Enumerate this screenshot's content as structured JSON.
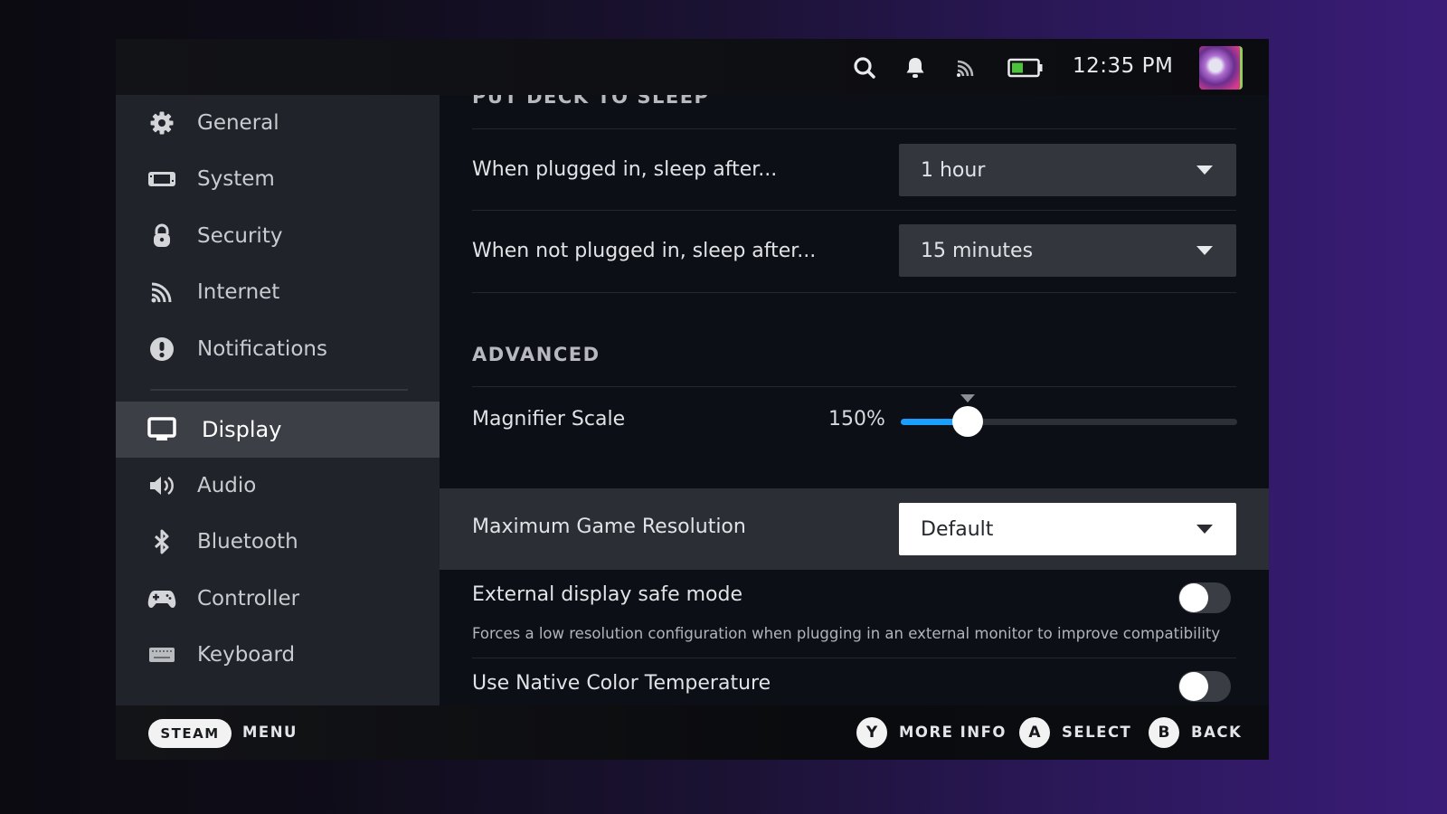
{
  "topbar": {
    "icons": [
      "search-icon",
      "bell-icon",
      "wifi-icon",
      "battery-icon"
    ],
    "battery_level_fraction": 0.45,
    "battery_color": "#4cc33a",
    "time": "12:35 PM"
  },
  "sidebar": {
    "items": [
      {
        "label": "General",
        "icon": "gear-icon"
      },
      {
        "label": "System",
        "icon": "system-icon"
      },
      {
        "label": "Security",
        "icon": "lock-icon"
      },
      {
        "label": "Internet",
        "icon": "wifi-icon"
      },
      {
        "label": "Notifications",
        "icon": "alert-icon"
      },
      {
        "label": "Display",
        "icon": "monitor-icon",
        "active": true
      },
      {
        "label": "Audio",
        "icon": "speaker-icon"
      },
      {
        "label": "Bluetooth",
        "icon": "bluetooth-icon"
      },
      {
        "label": "Controller",
        "icon": "gamepad-icon"
      },
      {
        "label": "Keyboard",
        "icon": "keyboard-icon"
      }
    ]
  },
  "content": {
    "sleep_section_title": "PUT DECK TO SLEEP",
    "plugged_label": "When plugged in, sleep after...",
    "plugged_value": "1 hour",
    "unplugged_label": "When not plugged in, sleep after...",
    "unplugged_value": "15 minutes",
    "advanced_title": "ADVANCED",
    "magnifier_label": "Magnifier Scale",
    "magnifier_value_text": "150%",
    "magnifier_fill_fraction": 0.2,
    "magnifier_default_fraction": 0.2,
    "accent_color": "#1a9fff",
    "max_res_label": "Maximum Game Resolution",
    "max_res_value": "Default",
    "safe_mode_label": "External display safe mode",
    "safe_mode_desc": "Forces a low resolution configuration when plugging in an external monitor to improve compatibility",
    "safe_mode_on": false,
    "native_color_label": "Use Native Color Temperature",
    "native_color_on": false
  },
  "footer": {
    "steam_label": "STEAM",
    "menu_label": "MENU",
    "y_key": "Y",
    "more_info_label": "MORE INFO",
    "a_key": "A",
    "select_label": "SELECT",
    "b_key": "B",
    "back_label": "BACK"
  }
}
